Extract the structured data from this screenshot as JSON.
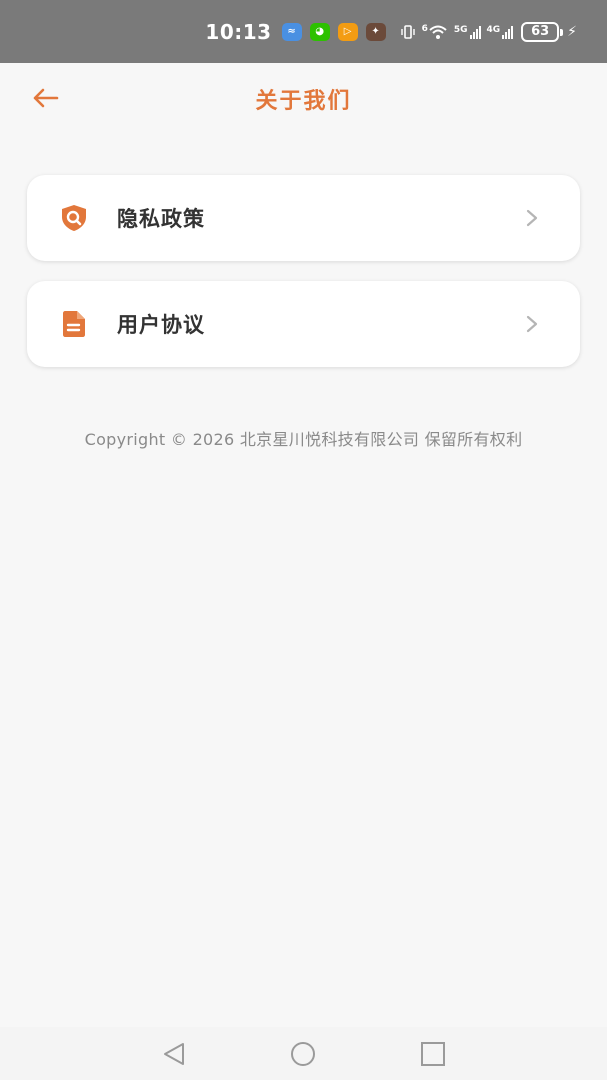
{
  "status_bar": {
    "time": "10:13",
    "battery": "63",
    "sig_5g": "5G",
    "sig_4g": "4G",
    "wifi_sup": "6",
    "colors": {
      "background": "#7a7a7a"
    }
  },
  "header": {
    "title": "关于我们",
    "accent_color": "#e2773b"
  },
  "menu": {
    "items": [
      {
        "label": "隐私政策",
        "icon": "shield-search-icon"
      },
      {
        "label": "用户协议",
        "icon": "document-icon"
      }
    ]
  },
  "footer": {
    "copyright": "Copyright © 2026 北京星川悦科技有限公司 保留所有权利"
  },
  "nav_bar": {
    "buttons": [
      "back-triangle-icon",
      "home-circle-icon",
      "recents-square-icon"
    ]
  }
}
